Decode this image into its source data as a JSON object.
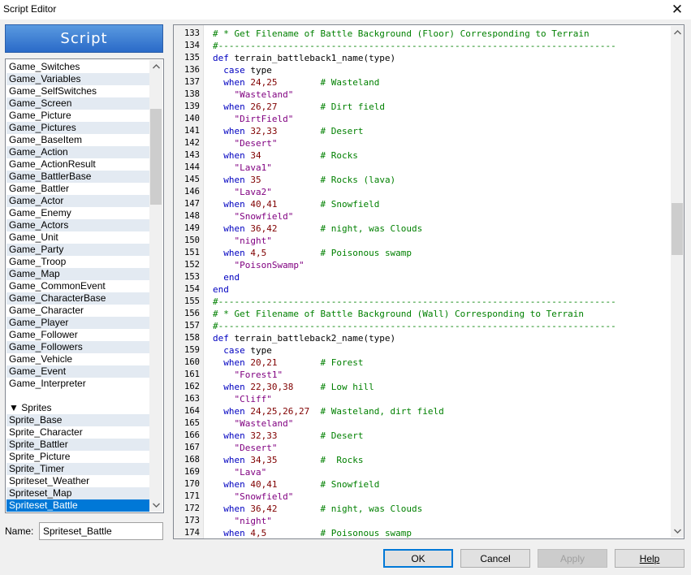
{
  "window": {
    "title": "Script Editor"
  },
  "sidebar": {
    "header": "Script",
    "items": [
      {
        "label": "Game_Switches",
        "type": "item"
      },
      {
        "label": "Game_Variables",
        "type": "item"
      },
      {
        "label": "Game_SelfSwitches",
        "type": "item"
      },
      {
        "label": "Game_Screen",
        "type": "item"
      },
      {
        "label": "Game_Picture",
        "type": "item"
      },
      {
        "label": "Game_Pictures",
        "type": "item"
      },
      {
        "label": "Game_BaseItem",
        "type": "item"
      },
      {
        "label": "Game_Action",
        "type": "item"
      },
      {
        "label": "Game_ActionResult",
        "type": "item"
      },
      {
        "label": "Game_BattlerBase",
        "type": "item"
      },
      {
        "label": "Game_Battler",
        "type": "item"
      },
      {
        "label": "Game_Actor",
        "type": "item"
      },
      {
        "label": "Game_Enemy",
        "type": "item"
      },
      {
        "label": "Game_Actors",
        "type": "item"
      },
      {
        "label": "Game_Unit",
        "type": "item"
      },
      {
        "label": "Game_Party",
        "type": "item"
      },
      {
        "label": "Game_Troop",
        "type": "item"
      },
      {
        "label": "Game_Map",
        "type": "item"
      },
      {
        "label": "Game_CommonEvent",
        "type": "item"
      },
      {
        "label": "Game_CharacterBase",
        "type": "item"
      },
      {
        "label": "Game_Character",
        "type": "item"
      },
      {
        "label": "Game_Player",
        "type": "item"
      },
      {
        "label": "Game_Follower",
        "type": "item"
      },
      {
        "label": "Game_Followers",
        "type": "item"
      },
      {
        "label": "Game_Vehicle",
        "type": "item"
      },
      {
        "label": "Game_Event",
        "type": "item"
      },
      {
        "label": "Game_Interpreter",
        "type": "item"
      },
      {
        "label": "",
        "type": "blank"
      },
      {
        "label": "▼ Sprites",
        "type": "section"
      },
      {
        "label": "Sprite_Base",
        "type": "item"
      },
      {
        "label": "Sprite_Character",
        "type": "item"
      },
      {
        "label": "Sprite_Battler",
        "type": "item"
      },
      {
        "label": "Sprite_Picture",
        "type": "item"
      },
      {
        "label": "Sprite_Timer",
        "type": "item"
      },
      {
        "label": "Spriteset_Weather",
        "type": "item"
      },
      {
        "label": "Spriteset_Map",
        "type": "item"
      },
      {
        "label": "Spriteset_Battle",
        "type": "selected"
      }
    ],
    "scrollbar": {
      "up_icon": "chevron-up-icon",
      "down_icon": "chevron-down-icon"
    }
  },
  "name_field": {
    "label": "Name:",
    "value": "Spriteset_Battle"
  },
  "code": {
    "lines": [
      {
        "n": "133",
        "t": [
          [
            "cm",
            "# * Get Filename of Battle Background (Floor) Corresponding to Terrain"
          ]
        ]
      },
      {
        "n": "134",
        "t": [
          [
            "cm",
            "#--------------------------------------------------------------------------"
          ]
        ]
      },
      {
        "n": "135",
        "t": [
          [
            "kw",
            "def "
          ],
          [
            "df",
            "terrain_battleback1_name(type)"
          ]
        ]
      },
      {
        "n": "136",
        "t": [
          [
            "kw",
            "  case "
          ],
          [
            "df",
            "type"
          ]
        ]
      },
      {
        "n": "137",
        "t": [
          [
            "kw",
            "  when "
          ],
          [
            "nm",
            "24,25"
          ],
          [
            "df",
            "        "
          ],
          [
            "cm",
            "# Wasteland"
          ]
        ]
      },
      {
        "n": "138",
        "t": [
          [
            "st",
            "    \"Wasteland\""
          ]
        ]
      },
      {
        "n": "139",
        "t": [
          [
            "kw",
            "  when "
          ],
          [
            "nm",
            "26,27"
          ],
          [
            "df",
            "        "
          ],
          [
            "cm",
            "# Dirt field"
          ]
        ]
      },
      {
        "n": "140",
        "t": [
          [
            "st",
            "    \"DirtField\""
          ]
        ]
      },
      {
        "n": "141",
        "t": [
          [
            "kw",
            "  when "
          ],
          [
            "nm",
            "32,33"
          ],
          [
            "df",
            "        "
          ],
          [
            "cm",
            "# Desert"
          ]
        ]
      },
      {
        "n": "142",
        "t": [
          [
            "st",
            "    \"Desert\""
          ]
        ]
      },
      {
        "n": "143",
        "t": [
          [
            "kw",
            "  when "
          ],
          [
            "nm",
            "34"
          ],
          [
            "df",
            "           "
          ],
          [
            "cm",
            "# Rocks"
          ]
        ]
      },
      {
        "n": "144",
        "t": [
          [
            "st",
            "    \"Lava1\""
          ]
        ]
      },
      {
        "n": "145",
        "t": [
          [
            "kw",
            "  when "
          ],
          [
            "nm",
            "35"
          ],
          [
            "df",
            "           "
          ],
          [
            "cm",
            "# Rocks (lava)"
          ]
        ]
      },
      {
        "n": "146",
        "t": [
          [
            "st",
            "    \"Lava2\""
          ]
        ]
      },
      {
        "n": "147",
        "t": [
          [
            "kw",
            "  when "
          ],
          [
            "nm",
            "40,41"
          ],
          [
            "df",
            "        "
          ],
          [
            "cm",
            "# Snowfield"
          ]
        ]
      },
      {
        "n": "148",
        "t": [
          [
            "st",
            "    \"Snowfield\""
          ]
        ]
      },
      {
        "n": "149",
        "t": [
          [
            "kw",
            "  when "
          ],
          [
            "nm",
            "36,42"
          ],
          [
            "df",
            "        "
          ],
          [
            "cm",
            "# night, was Clouds"
          ]
        ]
      },
      {
        "n": "150",
        "t": [
          [
            "st",
            "    \"night\""
          ]
        ]
      },
      {
        "n": "151",
        "t": [
          [
            "kw",
            "  when "
          ],
          [
            "nm",
            "4,5"
          ],
          [
            "df",
            "          "
          ],
          [
            "cm",
            "# Poisonous swamp"
          ]
        ]
      },
      {
        "n": "152",
        "t": [
          [
            "st",
            "    \"PoisonSwamp\""
          ]
        ]
      },
      {
        "n": "153",
        "t": [
          [
            "kw",
            "  end"
          ]
        ]
      },
      {
        "n": "154",
        "t": [
          [
            "kw",
            "end"
          ]
        ]
      },
      {
        "n": "155",
        "t": [
          [
            "cm",
            "#--------------------------------------------------------------------------"
          ]
        ]
      },
      {
        "n": "156",
        "t": [
          [
            "cm",
            "# * Get Filename of Battle Background (Wall) Corresponding to Terrain"
          ]
        ]
      },
      {
        "n": "157",
        "t": [
          [
            "cm",
            "#--------------------------------------------------------------------------"
          ]
        ]
      },
      {
        "n": "158",
        "t": [
          [
            "kw",
            "def "
          ],
          [
            "df",
            "terrain_battleback2_name(type)"
          ]
        ]
      },
      {
        "n": "159",
        "t": [
          [
            "kw",
            "  case "
          ],
          [
            "df",
            "type"
          ]
        ]
      },
      {
        "n": "160",
        "t": [
          [
            "kw",
            "  when "
          ],
          [
            "nm",
            "20,21"
          ],
          [
            "df",
            "        "
          ],
          [
            "cm",
            "# Forest"
          ]
        ]
      },
      {
        "n": "161",
        "t": [
          [
            "st",
            "    \"Forest1\""
          ]
        ]
      },
      {
        "n": "162",
        "t": [
          [
            "kw",
            "  when "
          ],
          [
            "nm",
            "22,30,38"
          ],
          [
            "df",
            "     "
          ],
          [
            "cm",
            "# Low hill"
          ]
        ]
      },
      {
        "n": "163",
        "t": [
          [
            "st",
            "    \"Cliff\""
          ]
        ]
      },
      {
        "n": "164",
        "t": [
          [
            "kw",
            "  when "
          ],
          [
            "nm",
            "24,25,26,27"
          ],
          [
            "df",
            "  "
          ],
          [
            "cm",
            "# Wasteland, dirt field"
          ]
        ]
      },
      {
        "n": "165",
        "t": [
          [
            "st",
            "    \"Wasteland\""
          ]
        ]
      },
      {
        "n": "166",
        "t": [
          [
            "kw",
            "  when "
          ],
          [
            "nm",
            "32,33"
          ],
          [
            "df",
            "        "
          ],
          [
            "cm",
            "# Desert"
          ]
        ]
      },
      {
        "n": "167",
        "t": [
          [
            "st",
            "    \"Desert\""
          ]
        ]
      },
      {
        "n": "168",
        "t": [
          [
            "kw",
            "  when "
          ],
          [
            "nm",
            "34,35"
          ],
          [
            "df",
            "        "
          ],
          [
            "cm",
            "#  Rocks"
          ]
        ]
      },
      {
        "n": "169",
        "t": [
          [
            "st",
            "    \"Lava\""
          ]
        ]
      },
      {
        "n": "170",
        "t": [
          [
            "kw",
            "  when "
          ],
          [
            "nm",
            "40,41"
          ],
          [
            "df",
            "        "
          ],
          [
            "cm",
            "# Snowfield"
          ]
        ]
      },
      {
        "n": "171",
        "t": [
          [
            "st",
            "    \"Snowfield\""
          ]
        ]
      },
      {
        "n": "172",
        "t": [
          [
            "kw",
            "  when "
          ],
          [
            "nm",
            "36,42"
          ],
          [
            "df",
            "        "
          ],
          [
            "cm",
            "# night, was Clouds"
          ]
        ]
      },
      {
        "n": "173",
        "t": [
          [
            "st",
            "    \"night\""
          ]
        ]
      },
      {
        "n": "174",
        "t": [
          [
            "kw",
            "  when "
          ],
          [
            "nm",
            "4,5"
          ],
          [
            "df",
            "          "
          ],
          [
            "cm",
            "# Poisonous swamp"
          ]
        ]
      }
    ]
  },
  "buttons": {
    "ok": "OK",
    "cancel": "Cancel",
    "apply": "Apply",
    "help": "Help"
  },
  "colors": {
    "keyword": "#0000c0",
    "comment": "#008000",
    "string": "#800080",
    "number": "#800000",
    "selection": "#0078d7"
  }
}
